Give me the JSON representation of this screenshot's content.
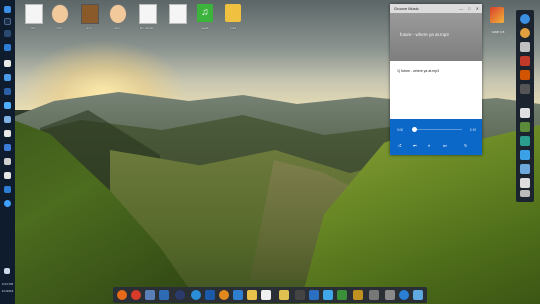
{
  "desktop_icons": [
    {
      "label": "S3",
      "kind": "file"
    },
    {
      "label": "xhh",
      "kind": "face"
    },
    {
      "label": "ai-h",
      "kind": "avatar"
    },
    {
      "label": "Ahe",
      "kind": "face"
    },
    {
      "label": "Flv Vandor",
      "kind": "file"
    },
    {
      "label": "",
      "kind": "file"
    },
    {
      "label": "tea2t",
      "kind": "music"
    },
    {
      "label": "Fuld",
      "kind": "folder"
    }
  ],
  "right_desktop_icon": {
    "label": "GIMP 2.8"
  },
  "left_taskbar": {
    "time": "9:23 PM",
    "date": "1/1/2016"
  },
  "music_window": {
    "title": "Groove Music",
    "controls": [
      "—",
      "□",
      "✕"
    ],
    "now_playing": "future - where ya at.mp3",
    "playlist": [
      "1) future - where ya at.mp3"
    ],
    "elapsed": "0:00",
    "duration": "2:19",
    "progress_fraction": 0.02,
    "buttons": [
      "⤮",
      "⏮",
      "⏸",
      "⏭",
      "↻"
    ]
  },
  "colors": {
    "accent": "#0c68c8",
    "taskbar": "#0e1c2e"
  },
  "right_dock_icons": [
    "browser-icon",
    "globe-icon",
    "photos-icon",
    "paint-icon",
    "game-icon",
    "app-icon",
    "note-icon",
    "cube-icon",
    "mail-icon",
    "tag-icon",
    "monitor-icon",
    "trash-icon",
    "store-icon"
  ],
  "bottom_dock_icons": [
    "firefox-icon",
    "chrome-icon",
    "settings-icon",
    "mail-icon",
    "video-icon",
    "edge-icon",
    "steam-icon",
    "calendar-icon",
    "files-icon",
    "photos-icon",
    "gimp-icon",
    "store-icon",
    "terminal-icon",
    "photoshop-icon",
    "music-icon",
    "notes-icon",
    "camera-icon",
    "cube-icon",
    "recycle-icon",
    "bin-icon"
  ]
}
